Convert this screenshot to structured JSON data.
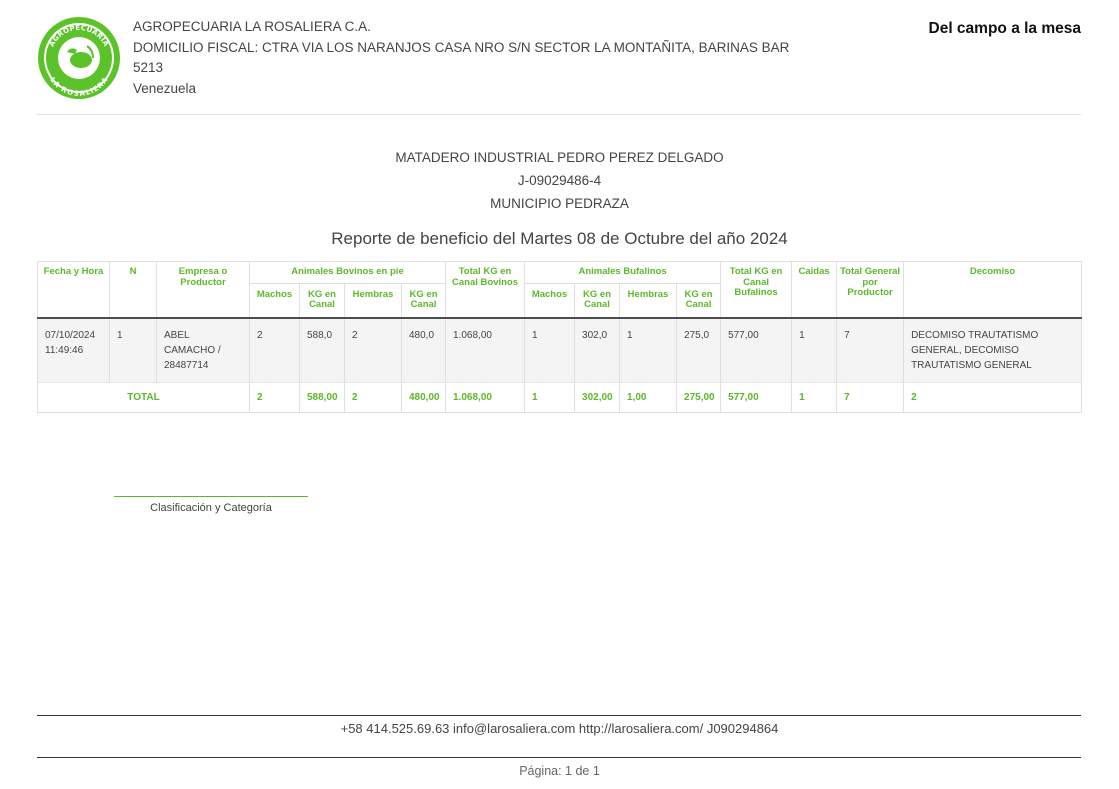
{
  "company": {
    "name": "AGROPECUARIA LA ROSALIERA C.A.",
    "address_line1": "DOMICILIO FISCAL: CTRA VIA LOS NARANJOS CASA NRO S/N SECTOR LA MONTAÑITA, BARINAS BAR",
    "address_line2": "5213",
    "country": "Venezuela",
    "slogan": "Del campo a la mesa",
    "logo": {
      "icon": "cow-seal-logo",
      "text_top": "AGROPECUARIA",
      "text_bottom": "LA ROSALIERA",
      "color": "#5cc22a"
    }
  },
  "client": {
    "name": "MATADERO INDUSTRIAL PEDRO PEREZ DELGADO",
    "rif": "J-09029486-4",
    "municipality": "MUNICIPIO PEDRAZA"
  },
  "report_title": "Reporte de beneficio del Martes 08 de Octubre del año 2024",
  "table": {
    "headers": {
      "fecha": "Fecha y Hora",
      "n": "N",
      "empresa": "Empresa o Productor",
      "bovinos_group": "Animales Bovinos en pie",
      "total_kg_bovinos": "Total KG en Canal Bovinos",
      "bufalinos_group": "Animales Bufalinos",
      "total_kg_bufalinos": "Total KG en Canal Bufalinos",
      "caidas": "Caidas",
      "total_general": "Total General por Productor",
      "decomiso": "Decomiso",
      "machos": "Machos",
      "kg_canal": "KG en Canal",
      "hembras": "Hembras"
    },
    "row": {
      "fecha": "07/10/2024 11:49:46",
      "n": "1",
      "empresa": "ABEL CAMACHO / 28487714",
      "bov_machos": "2",
      "bov_machos_kg": "588,0",
      "bov_hembras": "2",
      "bov_hembras_kg": "480,0",
      "total_kg_bovinos": "1.068,00",
      "buf_machos": "1",
      "buf_machos_kg": "302,0",
      "buf_hembras": "1",
      "buf_hembras_kg": "275,0",
      "total_kg_bufalinos": "577,00",
      "caidas": "1",
      "total_general": "7",
      "decomiso": "DECOMISO TRAUTATISMO GENERAL, DECOMISO TRAUTATISMO GENERAL"
    },
    "total": {
      "label": "TOTAL",
      "bov_machos": "2",
      "bov_machos_kg": "588,00",
      "bov_hembras": "2",
      "bov_hembras_kg": "480,00",
      "total_kg_bovinos": "1.068,00",
      "buf_machos": "1",
      "buf_machos_kg": "302,00",
      "buf_hembras": "1,00",
      "buf_hembras_kg": "275,00",
      "total_kg_bufalinos": "577,00",
      "caidas": "1",
      "total_general": "7",
      "decomiso": "2"
    }
  },
  "signature_label": "Clasificación y Categoría",
  "footer": {
    "contact": "+58 414.525.69.63 info@larosaliera.com http://larosaliera.com/ J090294864",
    "page": "Página: 1 de 1"
  },
  "colors": {
    "accent": "#5cb82a",
    "text": "#444444"
  }
}
